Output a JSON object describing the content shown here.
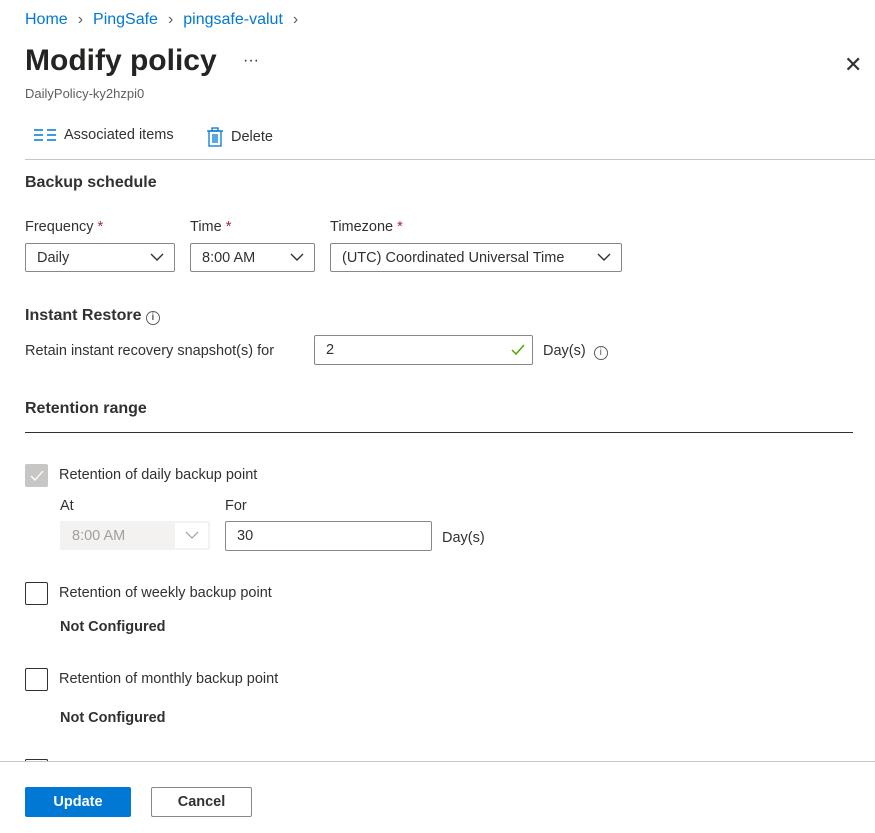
{
  "breadcrumb": [
    "Home",
    "PingSafe",
    "pingsafe-valut"
  ],
  "header": {
    "title": "Modify policy",
    "more": "···",
    "subtitle": "DailyPolicy-ky2hzpi0",
    "close": "✕"
  },
  "toolbar": {
    "associated": "Associated items",
    "delete": "Delete"
  },
  "schedule": {
    "heading": "Backup schedule",
    "frequency_label": "Frequency",
    "frequency_value": "Daily",
    "time_label": "Time",
    "time_value": "8:00 AM",
    "timezone_label": "Timezone",
    "timezone_value": "(UTC) Coordinated Universal Time",
    "required": "*"
  },
  "instant": {
    "heading": "Instant Restore",
    "retain_label": "Retain instant recovery snapshot(s) for",
    "retain_value": "2",
    "unit": "Day(s)"
  },
  "retention": {
    "heading": "Retention range",
    "daily": {
      "label": "Retention of daily backup point",
      "checked": true,
      "disabled": true,
      "at_label": "At",
      "at_value": "8:00 AM",
      "for_label": "For",
      "for_value": "30",
      "unit": "Day(s)"
    },
    "weekly": {
      "label": "Retention of weekly backup point",
      "checked": false,
      "status": "Not Configured"
    },
    "monthly": {
      "label": "Retention of monthly backup point",
      "checked": false,
      "status": "Not Configured"
    }
  },
  "footer": {
    "update": "Update",
    "cancel": "Cancel"
  },
  "colors": {
    "accent": "#0078d4",
    "valid": "#57a300"
  }
}
